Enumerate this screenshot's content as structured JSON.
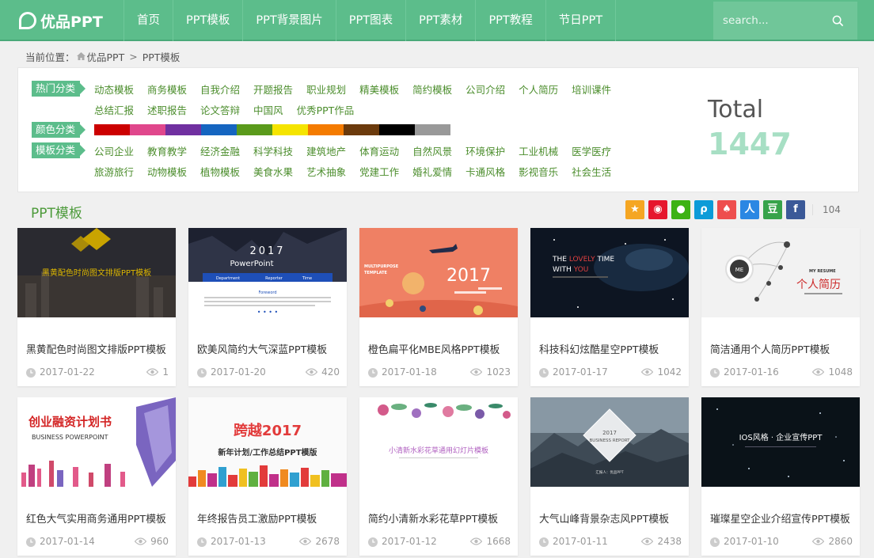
{
  "header": {
    "logo": "优品PPT",
    "menu": [
      "首页",
      "PPT模板",
      "PPT背景图片",
      "PPT图表",
      "PPT素材",
      "PPT教程",
      "节日PPT"
    ],
    "search_placeholder": "search..."
  },
  "breadcrumb": {
    "label": "当前位置：",
    "home": "优品PPT",
    "sep": ">",
    "current": "PPT模板"
  },
  "categories": {
    "hot_label": "热门分类",
    "hot_row1": [
      "动态模板",
      "商务模板",
      "自我介绍",
      "开题报告",
      "职业规划",
      "精美模板",
      "简约模板",
      "公司介绍",
      "个人简历",
      "培训课件"
    ],
    "hot_row2": [
      "总结汇报",
      "述职报告",
      "论文答辩",
      "中国风",
      "优秀PPT作品"
    ],
    "color_label": "颜色分类",
    "colors": [
      "#cc0000",
      "#e0478c",
      "#7030a0",
      "#1565c0",
      "#5a9a1b",
      "#f5e400",
      "#f47b00",
      "#6b3a0c",
      "#000000",
      "#999999"
    ],
    "template_label": "模板分类",
    "template_row1": [
      "公司企业",
      "教育教学",
      "经济金融",
      "科学科技",
      "建筑地产",
      "体育运动",
      "自然风景",
      "环境保护",
      "工业机械",
      "医学医疗"
    ],
    "template_row2": [
      "旅游旅行",
      "动物模板",
      "植物模板",
      "美食水果",
      "艺术抽象",
      "党建工作",
      "婚礼爱情",
      "卡通风格",
      "影视音乐",
      "社会生活"
    ],
    "total_label": "Total",
    "total_value": "1447"
  },
  "section": {
    "title": "PPT模板",
    "share_count": "104"
  },
  "cards": [
    {
      "title": "黑黄配色时尚图文排版PPT模板",
      "date": "2017-01-22",
      "views": "1"
    },
    {
      "title": "欧美风简约大气深蓝PPT模板",
      "date": "2017-01-20",
      "views": "420"
    },
    {
      "title": "橙色扁平化MBE风格PPT模板",
      "date": "2017-01-18",
      "views": "1023"
    },
    {
      "title": "科技科幻炫酷星空PPT模板",
      "date": "2017-01-17",
      "views": "1042"
    },
    {
      "title": "简洁通用个人简历PPT模板",
      "date": "2017-01-16",
      "views": "1048"
    },
    {
      "title": "红色大气实用商务通用PPT模板",
      "date": "2017-01-14",
      "views": "960"
    },
    {
      "title": "年终报告员工激励PPT模板",
      "date": "2017-01-13",
      "views": "2678"
    },
    {
      "title": "简约小清新水彩花草PPT模板",
      "date": "2017-01-12",
      "views": "1668"
    },
    {
      "title": "大气山峰背景杂志风PPT模板",
      "date": "2017-01-11",
      "views": "2438"
    },
    {
      "title": "璀璨星空企业介绍宣传PPT模板",
      "date": "2017-01-10",
      "views": "2860"
    }
  ],
  "thumbs": {
    "t1": "黑黄配色时尚图文排版PPT模板",
    "t2_year": "2017",
    "t2_title": "PowerPoint",
    "t2_bar": [
      "Department",
      "Reporter",
      "Time"
    ],
    "t2_foreword": "Foreword",
    "t3_multi": "MULTIPURPOSE",
    "t3_template": "TEMPLATE",
    "t3_year": "2017",
    "t4_line1a": "THE ",
    "t4_line1b": "LOVELY",
    "t4_line1c": " TIME",
    "t4_line2a": "WITH ",
    "t4_line2b": "YOU",
    "t5_me": "ME",
    "t5_resume": "MY RESUME",
    "t5_title": "个人简历",
    "t6_title": "创业融资计划书",
    "t6_sub": "BUSINESS POWERPOINT",
    "t7_brand": "跨越2017",
    "t7_title": "新年计划/工作总结PPT模版",
    "t8_title": "小清新水彩花草通用幻灯片模板",
    "t9_year": "2017",
    "t9_title": "BUSINESS REPORT",
    "t9_foot": "汇报人：优品PPT",
    "t10_title": "IOS风格 · 企业宣传PPT"
  }
}
